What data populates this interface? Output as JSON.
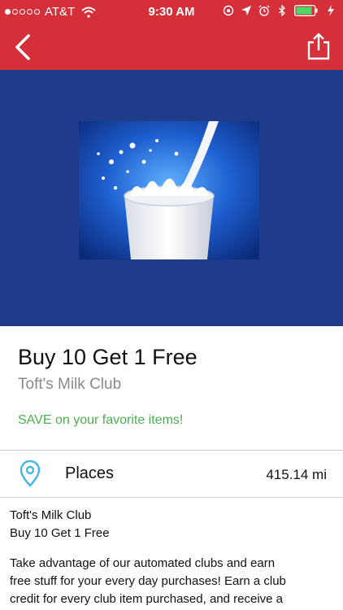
{
  "status_bar": {
    "carrier": "AT&T",
    "time": "9:30 AM"
  },
  "icons": {
    "back": "chevron-left-icon",
    "share": "share-icon",
    "places": "location-pin-icon"
  },
  "colors": {
    "nav_red": "#d5303a",
    "hero_blue": "#1f3c8a",
    "save_green": "#4caf50",
    "pin_blue": "#45b6e5"
  },
  "offer": {
    "title": "Buy 10 Get 1 Free",
    "club_name": "Toft's Milk Club",
    "save_text": "SAVE on your favorite items!"
  },
  "places": {
    "label": "Places",
    "distance": "415.14 mi"
  },
  "description": {
    "line1": "Toft's Milk Club",
    "line2": "Buy 10 Get 1 Free",
    "para1": "Take advantage of our automated clubs and earn",
    "para2": "free stuff for your every day purchases! Earn a club",
    "para3": "credit for every club item purchased, and receive a"
  }
}
